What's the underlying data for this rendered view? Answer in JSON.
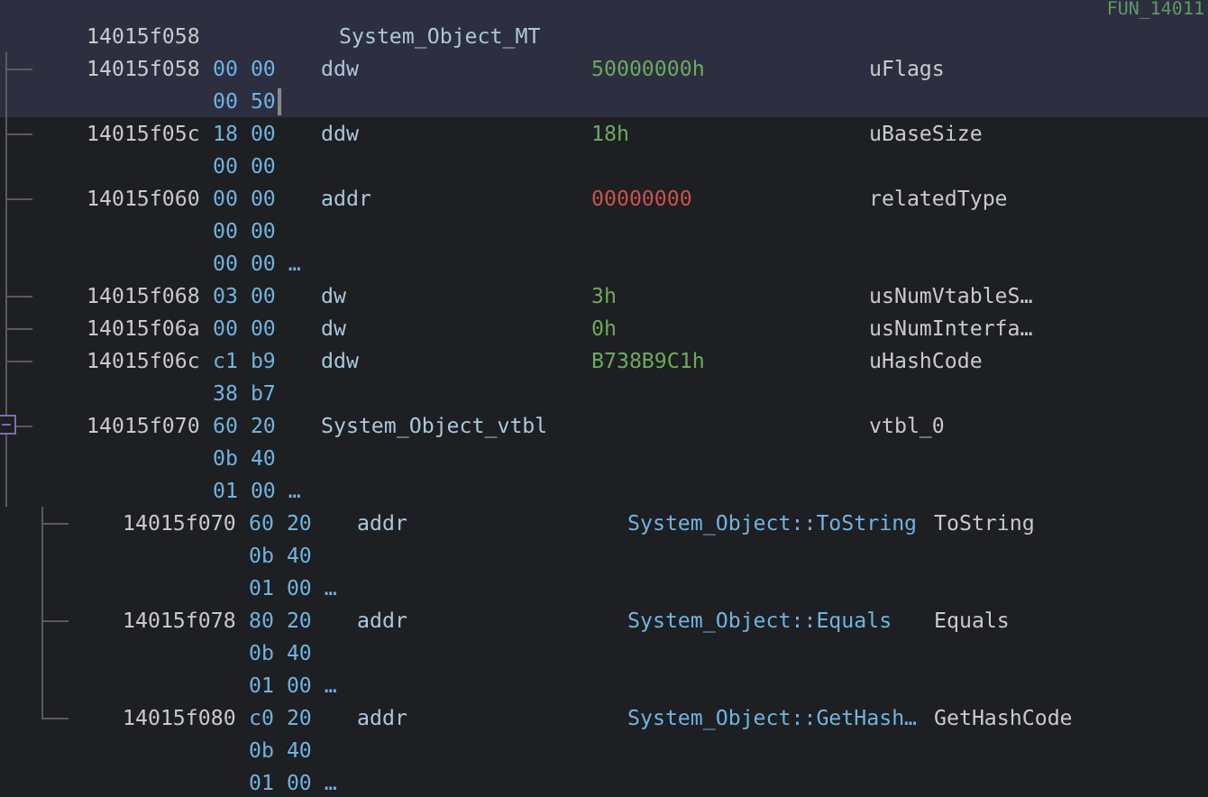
{
  "function_label": "FUN_14011",
  "label": {
    "address": "14015f058",
    "name": "System_Object_MT",
    "selected": true
  },
  "entries": [
    {
      "address": "14015f058",
      "bytes": [
        "00 00",
        "00 50"
      ],
      "mnemonic": "ddw",
      "operand": "50000000h",
      "kind": "number",
      "field": "uFlags",
      "selected": true
    },
    {
      "address": "14015f05c",
      "bytes": [
        "18 00",
        "00 00"
      ],
      "mnemonic": "ddw",
      "operand": "18h",
      "kind": "number",
      "field": "uBaseSize",
      "selected": false
    },
    {
      "address": "14015f060",
      "bytes": [
        "00 00",
        "00 00",
        "00 00 …"
      ],
      "mnemonic": "addr",
      "operand": "00000000",
      "kind": "invalid",
      "field": "relatedType",
      "selected": false
    },
    {
      "address": "14015f068",
      "bytes": [
        "03 00"
      ],
      "mnemonic": "dw",
      "operand": "3h",
      "kind": "number",
      "field": "usNumVtableS…",
      "selected": false
    },
    {
      "address": "14015f06a",
      "bytes": [
        "00 00"
      ],
      "mnemonic": "dw",
      "operand": "0h",
      "kind": "number",
      "field": "usNumInterfa…",
      "selected": false
    },
    {
      "address": "14015f06c",
      "bytes": [
        "c1 b9",
        "38 b7"
      ],
      "mnemonic": "ddw",
      "operand": "B738B9C1h",
      "kind": "number",
      "field": "uHashCode",
      "selected": false
    },
    {
      "address": "14015f070",
      "bytes": [
        "60 20",
        "0b 40",
        "01 00 …"
      ],
      "mnemonic": "System_Object_vtbl",
      "field": "vtbl_0",
      "selected": false,
      "expanded": true,
      "children": [
        {
          "address": "14015f070",
          "bytes": [
            "60 20",
            "0b 40",
            "01 00 …"
          ],
          "mnemonic": "addr",
          "operand": "System_Object::ToString",
          "kind": "reference",
          "field": "ToString",
          "selected": false
        },
        {
          "address": "14015f078",
          "bytes": [
            "80 20",
            "0b 40",
            "01 00 …"
          ],
          "mnemonic": "addr",
          "operand": "System_Object::Equals",
          "kind": "reference",
          "field": "Equals",
          "selected": false
        },
        {
          "address": "14015f080",
          "bytes": [
            "c0 20",
            "0b 40",
            "01 00 …"
          ],
          "mnemonic": "addr",
          "operand": "System_Object::GetHash…",
          "kind": "reference",
          "field": "GetHashCode",
          "selected": false
        }
      ]
    }
  ]
}
